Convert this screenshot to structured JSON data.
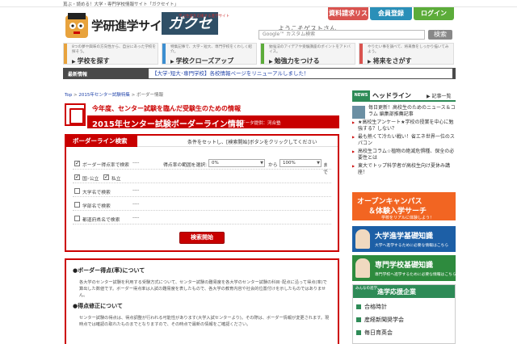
{
  "topbar": {
    "strapline": "蔦ぶ・読める！大学・専門学校情報サイト「ガクセイト」"
  },
  "header": {
    "logo_text": "学研進学サイト",
    "logo_box": "ガクセイト",
    "logo_tagline": "学ぶ生徒を応援する進学サイト",
    "welcome": "ようこそゲストさん",
    "doc_request": "資料請求リスト",
    "register": "会員登録",
    "login": "ログイン",
    "search_placeholder": "Google™ カスタム検索",
    "search_button": "検索"
  },
  "nav": [
    {
      "desc": "8つの夢や興味の方向性から、自分にあった学校を探そう。",
      "title": "学校を探す",
      "color": "#e8a33d"
    },
    {
      "desc": "特集記事で、大学・短大、専門学校をくわしく紹介。",
      "title": "学校クローズアップ",
      "color": "#3d8fd1"
    },
    {
      "desc": "勉強法のアイデアや受験講座のポイントをアドバイス。",
      "title": "勉強力をつける",
      "color": "#5cac3a"
    },
    {
      "desc": "やりたい事を調べて、将来像をしっかり描いてみよう。",
      "title": "将来をさがす",
      "color": "#d9534f"
    }
  ],
  "newsbar": {
    "label": "最新情報",
    "text": "【大学･短大･専門学校】各校情報ページをリニューアルしました！"
  },
  "breadcrumb": {
    "top": "Top",
    "sep1": ">",
    "section": "2015年センター試験特集",
    "sep2": ">",
    "current": "ボーダー情報"
  },
  "banner": {
    "subtitle": "今年度、センター試験を臨んだ受験生のための情報",
    "title": "2015年センター試験ボーダーライン情報",
    "source": "データ提供：河合塾"
  },
  "search_panel": {
    "header": "ボーダーライン検索",
    "hint": "条件をセットし、[検索開始]ボタンをクリックしてください",
    "rows": [
      {
        "checked": "✓",
        "label": "ボーダー得点率で検索",
        "value": "----"
      },
      {
        "checked": "✓",
        "label": "国･公立",
        "label2": "私立"
      },
      {
        "checked": "",
        "label": "大学名で検索",
        "value": "----"
      },
      {
        "checked": "",
        "label": "学部名で検索",
        "value": "----"
      },
      {
        "checked": "",
        "label": "都道府県名で検索",
        "value": "----"
      }
    ],
    "range_label": "得点率の範囲を選択:",
    "range_from": "0%",
    "range_mid": "から",
    "range_to": "100%",
    "range_end": "まで",
    "dropdown": "▼",
    "submit": "検索開始"
  },
  "info": {
    "h1": "●ボーダー得点(率)について",
    "p1": "各大学のセンター試験を利用する受験方式について、センター試験の難易度を各大学のセンター試験の科目･配点に沿って得点(率)で算出した数値です。ボーダー得点率は入試の難易度を表したもので、各大学の教育内容や社会的位置付けを示したものではありません。",
    "h2": "●得点修正について",
    "p2": "センター試験の得点は、得点調整が行われる可能性があります(大学入試センターより)。その際は、ボーダー情報が変更されます。現時点では確認の取れたものまでとなりますので、その時点で最新の情報をご確認ください。"
  },
  "headline": {
    "news_tag": "NEWS",
    "label": "ヘッドライン",
    "more": "記事一覧",
    "items": [
      "毎日更新！高校生のためのニュース＆コラム 編集部推薦記事",
      "★高校生アンケート★学校の授業を中心に勉強する？しない？",
      "最も熱くて冷たい戦い！省エネ世界一位のスパコン",
      "高校生コラム☆植物の絶滅危惧種、保全の必要性とは",
      "東大でトップ科学者が高校生向け夏休み講座！"
    ]
  },
  "banners": {
    "oc_line1": "オープンキャンパス",
    "oc_line2": "＆体験入学サーチ",
    "oc_line3": "学校をリアルに体験しよう！",
    "univ_title": "大学進学基礎知識",
    "univ_sub": "大学へ進学するために必要な情報はこちら",
    "voc_title": "専門学校基礎知識",
    "voc_sub": "専門学校へ進学するために必要な情報はこちら"
  },
  "support": {
    "tag": "みんなの進学",
    "title": "進学応援企業",
    "items": [
      "合格時計",
      "産経新聞奨学会",
      "毎日育英会"
    ]
  }
}
